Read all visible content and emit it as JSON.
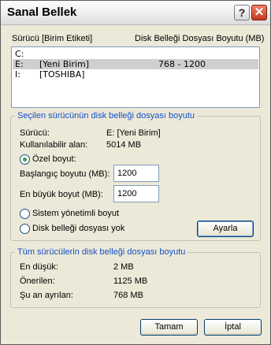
{
  "window": {
    "title": "Sanal Bellek"
  },
  "drive_list": {
    "headers": {
      "drive": "Sürücü",
      "label": "[Birim Etiketi]",
      "size": "Disk Belleği Dosyası Boyutu (MB)"
    },
    "rows": [
      {
        "drive": "C:",
        "label": "",
        "size": "",
        "selected": false
      },
      {
        "drive": "E:",
        "label": "[Yeni Birim]",
        "size": "768 - 1200",
        "selected": true
      },
      {
        "drive": "I:",
        "label": "[TOSHIBA]",
        "size": "",
        "selected": false
      }
    ]
  },
  "selected_drive_group": {
    "legend": "Seçilen sürücünün disk belleği dosyası boyutu",
    "drive_label": "Sürücü:",
    "drive_value": "E:  [Yeni Birim]",
    "available_label": "Kullanılabilir alan:",
    "available_value": "5014 MB",
    "custom_size_label": "Özel boyut:",
    "initial_size_label": "Başlangıç boyutu (MB):",
    "initial_size_value": "1200",
    "max_size_label": "En büyük boyut (MB):",
    "max_size_value": "1200",
    "system_managed_label": "Sistem yönetimli boyut",
    "no_paging_label": "Disk belleği dosyası yok",
    "set_button": "Ayarla",
    "selected_option": "custom_size"
  },
  "all_drives_group": {
    "legend": "Tüm sürücülerin disk belleği dosyası boyutu",
    "minimum_label": "En düşük:",
    "minimum_value": "2 MB",
    "recommended_label": "Önerilen:",
    "recommended_value": "1125 MB",
    "allocated_label": "Şu an ayrılan:",
    "allocated_value": "768 MB"
  },
  "footer": {
    "ok_button": "Tamam",
    "cancel_button": "İptal"
  },
  "colors": {
    "group_legend": "#1550c8",
    "window_bg": "#ece9d8",
    "selected_row": "#cfcfcf"
  }
}
